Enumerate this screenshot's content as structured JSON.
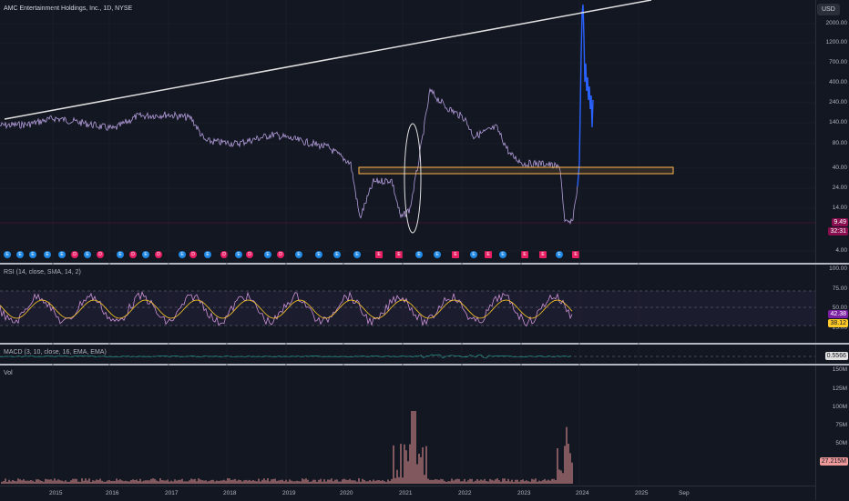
{
  "header": {
    "title": "AMC Entertainment Holdings, Inc., 1D, NYSE",
    "currency": "USD"
  },
  "price_axis": {
    "ticks": [
      "2000.00",
      "1200.00",
      "700.00",
      "400.00",
      "240.00",
      "140.00",
      "80.00",
      "40.00",
      "24.00",
      "14.00",
      "4.00"
    ],
    "last_price": "9.49",
    "countdown": "32:31"
  },
  "rsi": {
    "title": "RSI (14, close, SMA, 14, 2)",
    "ticks": [
      "100.00",
      "75.00",
      "50.00",
      "25.00"
    ],
    "value": "42.38",
    "ma_value": "38.12"
  },
  "macd": {
    "title": "MACD (3, 10, close, 16, EMA, EMA)",
    "value": "0.5566"
  },
  "volume": {
    "title": "Vol",
    "ticks": [
      "150M",
      "125M",
      "100M",
      "75M",
      "50M",
      "25M"
    ],
    "value": "27.215M"
  },
  "time_axis": {
    "labels": [
      "2015",
      "2016",
      "2017",
      "2018",
      "2019",
      "2020",
      "2021",
      "2022",
      "2023",
      "2024",
      "2025",
      "Sep"
    ]
  },
  "colors": {
    "background": "#131722",
    "price_line": "#b39ddb",
    "projection": "#2962ff",
    "trend_line": "#e0e0e0",
    "zone": "#ffb74d",
    "rsi_line": "#ce93d8",
    "rsi_ma": "#ffca28",
    "earnings_badge": "#2196f3",
    "dividend_badge": "#e91e63"
  }
}
